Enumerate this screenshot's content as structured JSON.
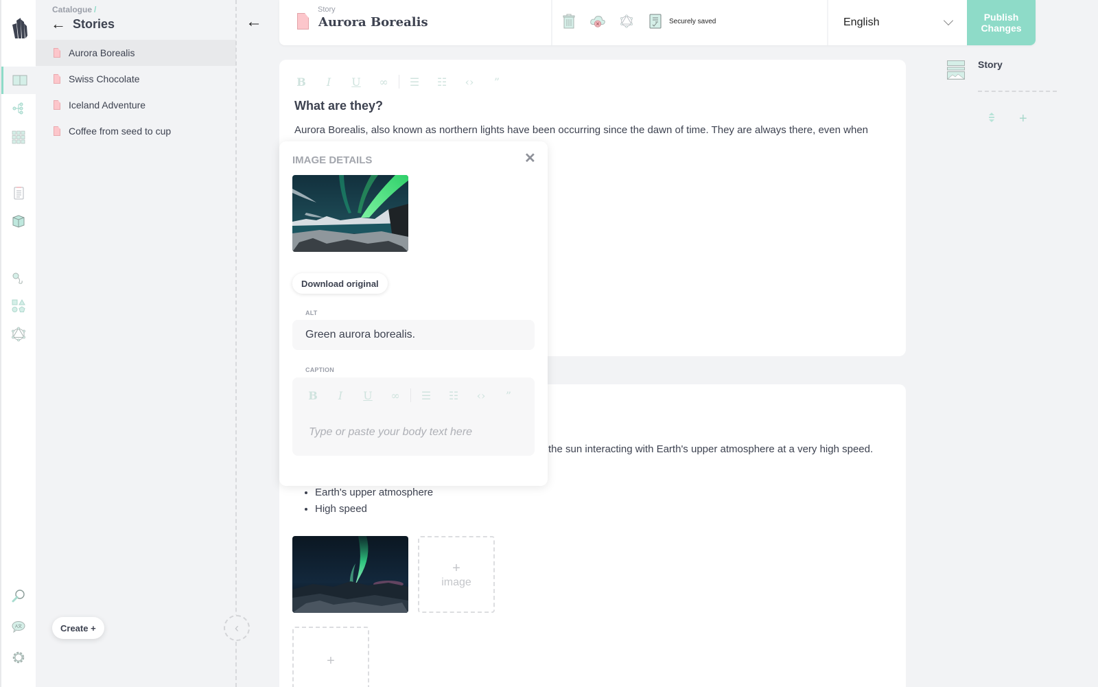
{
  "rail": {
    "items": [
      {
        "name": "stories",
        "icon": "book-icon",
        "active": true
      },
      {
        "name": "relations",
        "icon": "hierarchy-icon",
        "active": false
      },
      {
        "name": "grid",
        "icon": "grid-icon",
        "active": false
      },
      {
        "name": "documents",
        "icon": "clipboard-icon",
        "active": false
      },
      {
        "name": "products",
        "icon": "box-icon",
        "active": false
      },
      {
        "name": "hooks",
        "icon": "hook-icon",
        "active": false
      },
      {
        "name": "shapes",
        "icon": "shapes-icon",
        "active": false
      },
      {
        "name": "graphql",
        "icon": "graphql-icon",
        "active": false
      },
      {
        "name": "search",
        "icon": "search-icon",
        "active": false
      },
      {
        "name": "translations",
        "icon": "translate-icon",
        "active": false
      },
      {
        "name": "settings",
        "icon": "gear-icon",
        "active": false
      }
    ]
  },
  "stories_panel": {
    "breadcrumb": "Catalogue",
    "breadcrumb_sep": "/",
    "title": "Stories",
    "back_glyph": "←",
    "items": [
      {
        "label": "Aurora Borealis",
        "active": true
      },
      {
        "label": "Swiss Chocolate",
        "active": false
      },
      {
        "label": "Iceland Adventure",
        "active": false
      },
      {
        "label": "Coffee from seed to cup",
        "active": false
      }
    ],
    "create_label": "Create +",
    "collapse_glyph": "‹"
  },
  "main_back_glyph": "←",
  "topbar": {
    "type_label": "Story",
    "title": "Aurora Borealis",
    "save_status": "Securely saved",
    "language": "English",
    "publish_label_line1": "Publish",
    "publish_label_line2": "Changes"
  },
  "structure_panel": {
    "label": "Story"
  },
  "editor": {
    "toolbar": [
      "bold",
      "italic",
      "underline",
      "link",
      "bullet-list",
      "numbered-list",
      "code",
      "quote"
    ],
    "heading": "What are they?",
    "paragraph1": "Aurora Borealis, also known as northern lights have been occurring since the dawn of time. They are always there, even when",
    "paragraph2_visible": "the sun interacting with Earth's upper atmosphere at a very high speed.",
    "bullets": [
      "Earth's upper atmosphere",
      "High speed"
    ],
    "add_image_label": "image",
    "plus": "+"
  },
  "image_details": {
    "title": "IMAGE DETAILS",
    "close_glyph": "✕",
    "download_label": "Download original",
    "alt_label": "ALT",
    "alt_value": "Green aurora borealis.",
    "caption_label": "CAPTION",
    "caption_placeholder": "Type or paste your body text here"
  },
  "colors": {
    "accent": "#8edbc8",
    "doc_pink": "#fcc6cb",
    "background": "#f2f3f5",
    "text": "#3d4250"
  }
}
